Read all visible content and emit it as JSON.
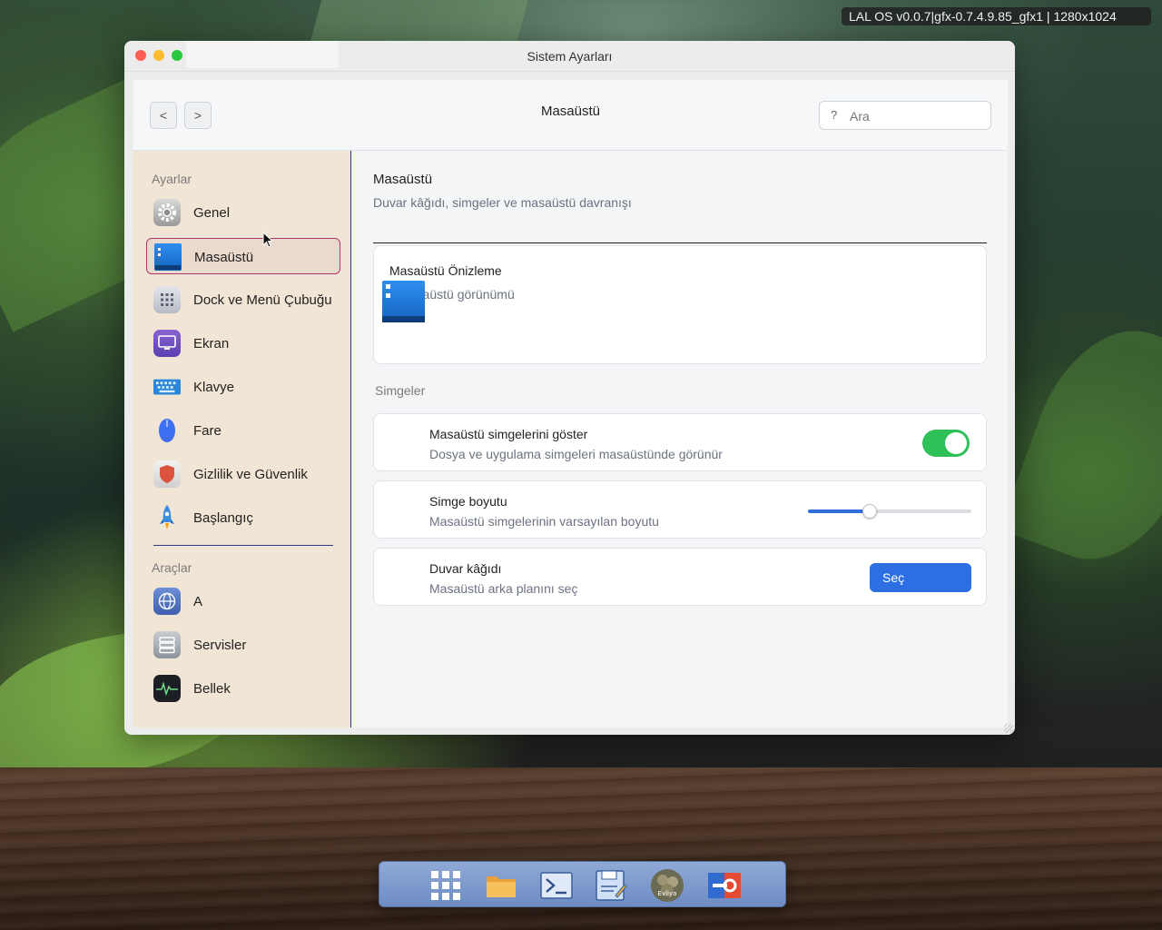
{
  "system_bar": {
    "text": "LAL OS v0.0.7|gfx-0.7.4.9.85_gfx1 | 1280x1024"
  },
  "window": {
    "title": "Sistem Ayarları"
  },
  "header": {
    "back_label": "<",
    "forward_label": ">",
    "title": "Masaüstü",
    "search_icon": "?",
    "search_placeholder": "Ara"
  },
  "sidebar": {
    "section_settings": "Ayarlar",
    "section_tools": "Araçlar",
    "items": [
      {
        "label": "Genel",
        "icon": "gear-icon",
        "active": false
      },
      {
        "label": "Masaüstü",
        "icon": "desktop-icon",
        "active": true
      },
      {
        "label": "Dock ve Menü Çubuğu",
        "icon": "dock-icon",
        "active": false
      },
      {
        "label": "Ekran",
        "icon": "monitor-icon",
        "active": false
      },
      {
        "label": "Klavye",
        "icon": "keyboard-icon",
        "active": false
      },
      {
        "label": "Fare",
        "icon": "mouse-icon",
        "active": false
      },
      {
        "label": "Gizlilik ve Güvenlik",
        "icon": "shield-icon",
        "active": false
      },
      {
        "label": "Başlangıç",
        "icon": "rocket-icon",
        "active": false
      }
    ],
    "tools": [
      {
        "label": "A",
        "icon": "globe-icon"
      },
      {
        "label": "Servisler",
        "icon": "server-icon"
      },
      {
        "label": "Bellek",
        "icon": "activity-icon"
      }
    ]
  },
  "main": {
    "title": "Masaüstü",
    "subtitle": "Duvar kâğıdı, simgeler ve masaüstü davranışı",
    "preview": {
      "title": "Masaüstü Önizleme",
      "subtitle": "li masaüstü görünümü"
    },
    "group_label": "Simgeler",
    "rows": {
      "show_icons": {
        "title": "Masaüstü simgelerini göster",
        "subtitle": "Dosya ve uygulama simgeleri masaüstünde görünür",
        "enabled": true
      },
      "icon_size": {
        "title": "Simge boyutu",
        "subtitle": "Masaüstü simgelerinin varsayılan boyutu",
        "value_fraction": 0.38
      },
      "wallpaper": {
        "title": "Duvar kâğıdı",
        "subtitle": "Masaüstü arka planını seç",
        "button_label": "Seç"
      }
    }
  },
  "dock": {
    "items": [
      "app-grid-icon",
      "folder-icon",
      "terminal-icon",
      "text-editor-icon",
      "evliya-icon",
      "settings-tools-icon"
    ],
    "evliya_text": "Evliya"
  },
  "colors": {
    "accent": "#2d6fe3",
    "toggle_on": "#2fc157",
    "sidebar_bg": "#f1e5d5",
    "active_border": "#b0366f"
  }
}
